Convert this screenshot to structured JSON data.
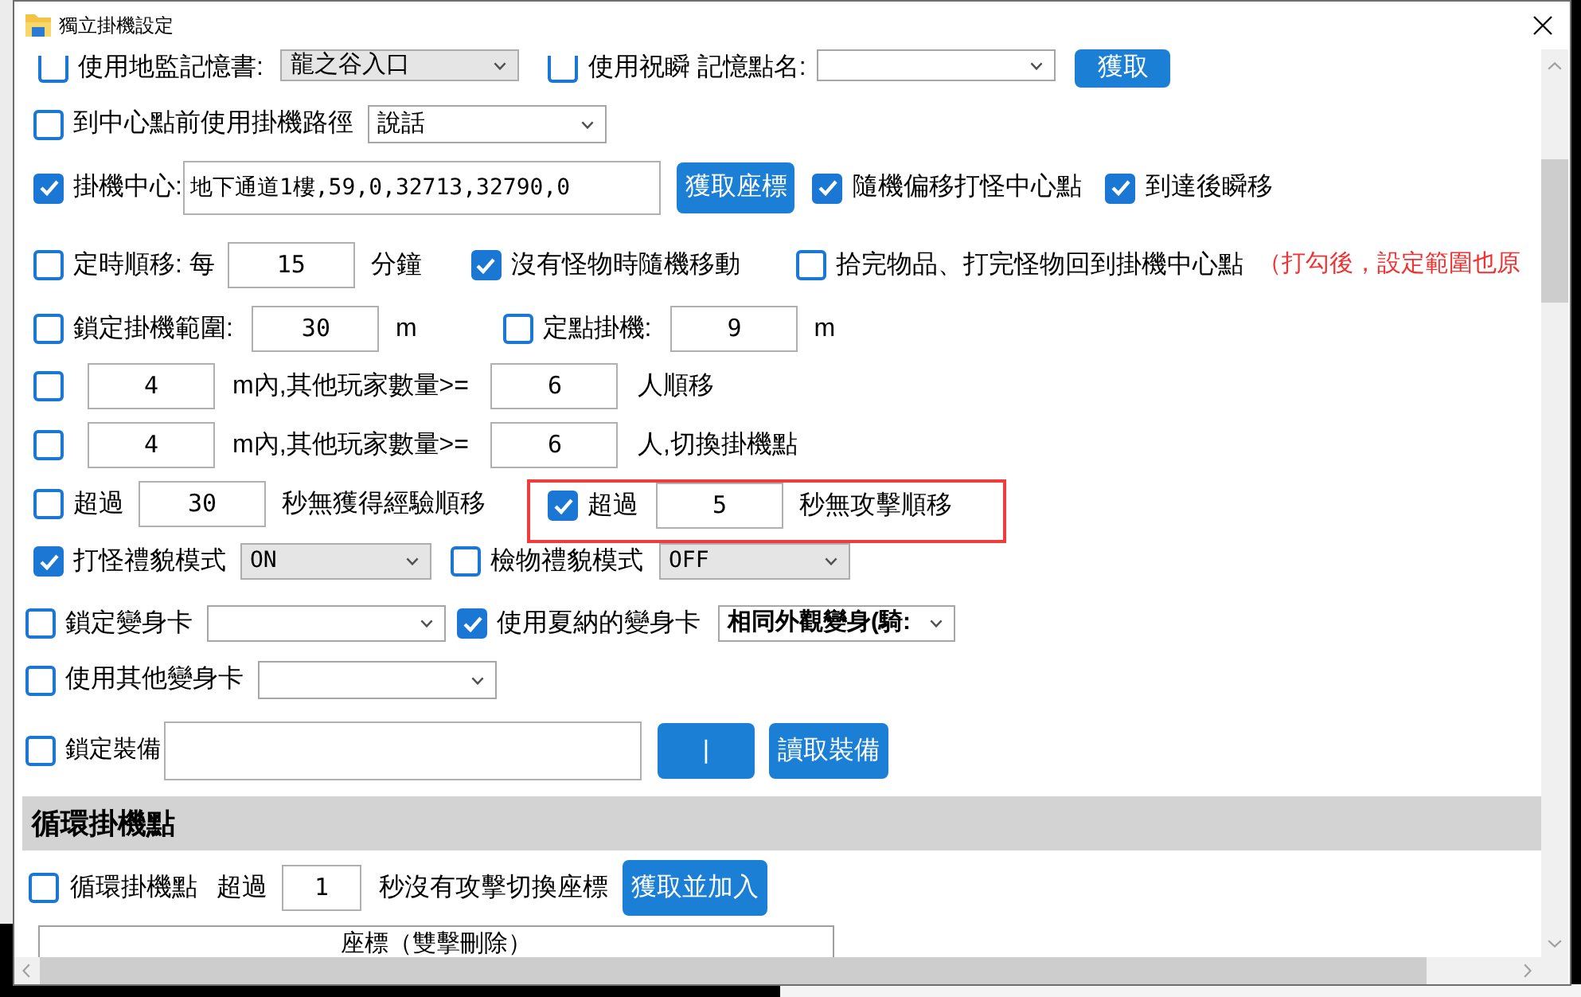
{
  "window": {
    "title": "獨立掛機設定"
  },
  "rows": [
    {
      "items": [
        {
          "kind": "checkbox",
          "label": "使用地監記憶書:",
          "checked": false
        },
        {
          "kind": "select",
          "value": "龍之谷入口"
        },
        {
          "kind": "checkbox",
          "label": "使用祝瞬 記憶點名:",
          "checked": false
        },
        {
          "kind": "combo"
        },
        {
          "kind": "button",
          "label": "獲取"
        }
      ]
    },
    {
      "items": [
        {
          "kind": "checkbox",
          "label": "到中心點前使用掛機路徑",
          "checked": false
        },
        {
          "kind": "combo",
          "value": "說話"
        }
      ]
    },
    {
      "items": [
        {
          "kind": "checkbox",
          "label": "掛機中心:",
          "checked": true
        },
        {
          "kind": "input",
          "value": "地下通道1樓,59,0,32713,32790,0"
        },
        {
          "kind": "button",
          "label": "獲取座標"
        },
        {
          "kind": "checkbox",
          "label": "隨機偏移打怪中心點",
          "checked": true
        },
        {
          "kind": "checkbox",
          "label": "到達後瞬移",
          "checked": true
        }
      ]
    },
    {
      "items": [
        {
          "kind": "checkbox",
          "label": "定時順移: 每",
          "checked": false
        },
        {
          "kind": "input",
          "value": "15"
        },
        {
          "kind": "text",
          "text": "分鐘"
        },
        {
          "kind": "checkbox",
          "label": "沒有怪物時隨機移動",
          "checked": true
        },
        {
          "kind": "checkbox",
          "label": "拾完物品、打完怪物回到掛機中心點",
          "checked": false
        },
        {
          "kind": "warning",
          "text": "（打勾後，設定範圍也原"
        }
      ]
    },
    {
      "items": [
        {
          "kind": "checkbox",
          "label": "鎖定掛機範圍:",
          "checked": false
        },
        {
          "kind": "input",
          "value": "30"
        },
        {
          "kind": "text",
          "text": "m"
        },
        {
          "kind": "checkbox",
          "label": "定點掛機:",
          "checked": false
        },
        {
          "kind": "input",
          "value": "9"
        },
        {
          "kind": "text",
          "text": "m"
        }
      ]
    },
    {
      "items": [
        {
          "kind": "checkbox",
          "checked": false
        },
        {
          "kind": "input",
          "value": "4"
        },
        {
          "kind": "text",
          "text": "m內,其他玩家數量>="
        },
        {
          "kind": "input",
          "value": "6"
        },
        {
          "kind": "text",
          "text": "人順移"
        }
      ]
    },
    {
      "items": [
        {
          "kind": "checkbox",
          "checked": false
        },
        {
          "kind": "input",
          "value": "4"
        },
        {
          "kind": "text",
          "text": "m內,其他玩家數量>="
        },
        {
          "kind": "input",
          "value": "6"
        },
        {
          "kind": "text",
          "text": "人,切換掛機點"
        }
      ]
    },
    {
      "items": [
        {
          "kind": "checkbox",
          "label": "超過",
          "checked": false
        },
        {
          "kind": "input",
          "value": "30"
        },
        {
          "kind": "text",
          "text": "秒無獲得經驗順移"
        },
        {
          "kind": "group",
          "highlighted": true,
          "items": [
            {
              "kind": "checkbox",
              "label": "超過",
              "checked": true
            },
            {
              "kind": "input",
              "value": "5"
            },
            {
              "kind": "text",
              "text": "秒無攻擊順移"
            }
          ]
        }
      ]
    },
    {
      "items": [
        {
          "kind": "checkbox",
          "label": "打怪禮貌模式",
          "checked": true
        },
        {
          "kind": "select",
          "value": "ON"
        },
        {
          "kind": "checkbox",
          "label": "檢物禮貌模式",
          "checked": false
        },
        {
          "kind": "select",
          "value": "OFF"
        }
      ]
    },
    {
      "items": [
        {
          "kind": "checkbox",
          "label": "鎖定變身卡",
          "checked": false
        },
        {
          "kind": "combo"
        },
        {
          "kind": "checkbox",
          "label": "使用夏納的變身卡",
          "checked": true
        },
        {
          "kind": "combo",
          "value": "相同外觀變身(騎:"
        }
      ]
    },
    {
      "items": [
        {
          "kind": "checkbox",
          "label": "使用其他變身卡",
          "checked": false
        },
        {
          "kind": "combo"
        }
      ]
    },
    {
      "items": [
        {
          "kind": "checkbox",
          "label": "鎖定裝備",
          "checked": false
        },
        {
          "kind": "input"
        },
        {
          "kind": "button",
          "label": "|"
        },
        {
          "kind": "button",
          "label": "讀取裝備"
        }
      ]
    }
  ],
  "loop_section": {
    "title": "循環掛機點",
    "rows": [
      {
        "items": [
          {
            "kind": "checkbox",
            "label": "循環掛機點",
            "checked": false
          },
          {
            "kind": "text",
            "text": "超過"
          },
          {
            "kind": "input",
            "value": "1"
          },
          {
            "kind": "text",
            "text": "秒沒有攻擊切換座標"
          },
          {
            "kind": "button",
            "label": "獲取並加入"
          }
        ]
      }
    ],
    "list": {
      "columns": [
        "座標（雙擊刪除）"
      ]
    }
  }
}
